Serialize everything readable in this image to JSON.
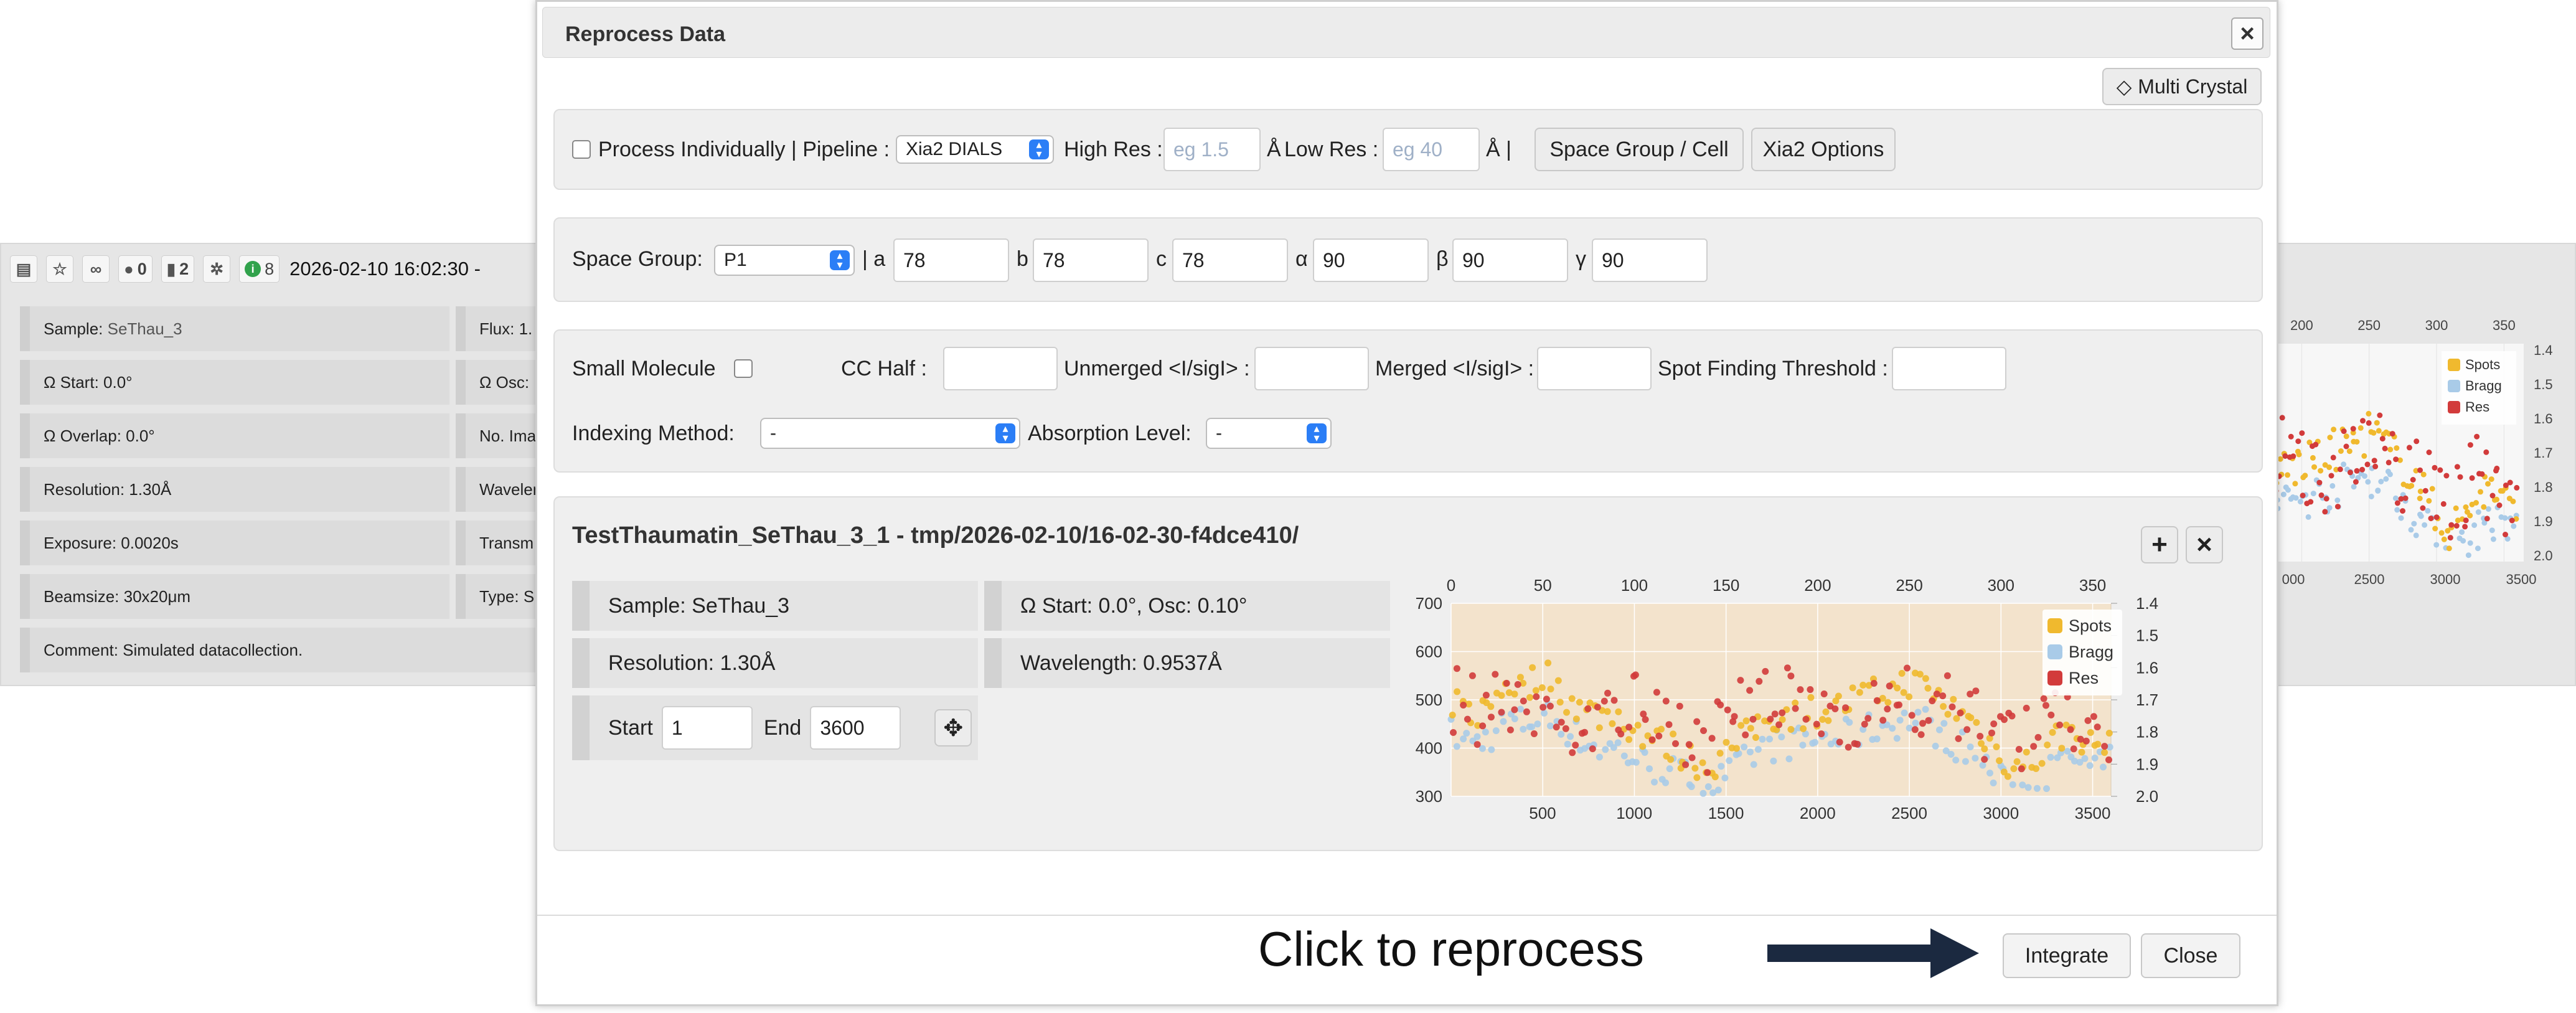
{
  "background": {
    "toolbar": {
      "comments_count": "0",
      "files_count": "2",
      "info_count": "8",
      "datetime": "2026-02-10 16:02:30 -"
    },
    "left_rows": [
      {
        "label": "Sample: ",
        "value": "SeThau_3"
      },
      {
        "label": "Ω Start: 0.0°",
        "value": ""
      },
      {
        "label": "Ω Overlap: 0.0°",
        "value": ""
      },
      {
        "label": "Resolution: 1.30Å",
        "value": ""
      },
      {
        "label": "Exposure: 0.0020s",
        "value": ""
      },
      {
        "label": "Beamsize: 30x20μm",
        "value": ""
      },
      {
        "label": "Comment: Simulated datacollection.",
        "value": ""
      }
    ],
    "right_col_rows": [
      "Flux: 1.",
      "Ω Osc: ",
      "No. Ima",
      "Wavelen",
      "Transm",
      "Type: S"
    ],
    "right_chart": {
      "x_top_ticks": [
        "200",
        "250",
        "300",
        "350"
      ],
      "x_bottom_ticks": [
        "000",
        "2500",
        "3000",
        "3500"
      ],
      "y_right_ticks": [
        "1.4",
        "1.5",
        "1.6",
        "1.7",
        "1.8",
        "1.9",
        "2.0"
      ],
      "legend": [
        "Spots",
        "Bragg",
        "Res"
      ]
    }
  },
  "modal": {
    "title": "Reprocess Data",
    "multi_crystal_label": "Multi Crystal",
    "pipeline_panel": {
      "process_individually_label": "Process Individually | Pipeline :",
      "pipeline_value": "Xia2 DIALS",
      "high_res_label": "High Res :",
      "high_res_placeholder": "eg 1.5",
      "angstrom_unit": "Å",
      "low_res_label": "Low Res :",
      "low_res_placeholder": "eg 40",
      "angstrom_sep": "Å |",
      "space_group_cell_button": "Space Group / Cell",
      "xia2_options_button": "Xia2 Options"
    },
    "cell_panel": {
      "space_group_label": "Space Group:",
      "space_group_value": "P1",
      "a_label": "| a",
      "a_value": "78",
      "b_label": "b",
      "b_value": "78",
      "c_label": "c",
      "c_value": "78",
      "alpha_label": "α",
      "alpha_value": "90",
      "beta_label": "β",
      "beta_value": "90",
      "gamma_label": "γ",
      "gamma_value": "90"
    },
    "options_panel": {
      "small_molecule_label": "Small Molecule",
      "cc_half_label": "CC Half :",
      "unmerged_label": "Unmerged <I/sigI> :",
      "merged_label": "Merged <I/sigI> :",
      "spot_threshold_label": "Spot Finding Threshold :",
      "indexing_method_label": "Indexing Method:",
      "indexing_method_value": "-",
      "absorption_level_label": "Absorption Level:",
      "absorption_level_value": "-"
    },
    "dataset": {
      "title": "TestThaumatin_SeThau_3_1 - tmp/2026-02-10/16-02-30-f4dce410/",
      "sample": "Sample: SeThau_3",
      "omega": "Ω Start: 0.0°, Osc: 0.10°",
      "resolution": "Resolution: 1.30Å",
      "wavelength": "Wavelength: 0.9537Å",
      "start_label": "Start",
      "start_value": "1",
      "end_label": "End",
      "end_value": "3600"
    },
    "footer": {
      "annotation": "Click to reprocess",
      "integrate_button": "Integrate",
      "close_button": "Close"
    }
  },
  "colors": {
    "spots": "#f0b92e",
    "bragg": "#a9cbe8",
    "res": "#d23b3b",
    "plot_bg": "#f3e3cc",
    "arrow": "#1b2940"
  },
  "chart_data": {
    "type": "scatter",
    "x_top_ticks": [
      "0",
      "50",
      "100",
      "150",
      "200",
      "250",
      "300",
      "350"
    ],
    "x_bottom_ticks": [
      "500",
      "1000",
      "1500",
      "2000",
      "2500",
      "3000",
      "3500"
    ],
    "y_left_ticks": [
      "700",
      "600",
      "500",
      "400",
      "300"
    ],
    "y_right_ticks": [
      "1.4",
      "1.5",
      "1.6",
      "1.7",
      "1.8",
      "1.9",
      "2.0"
    ],
    "x_top_range": [
      0,
      360
    ],
    "x_bottom_range": [
      1,
      3600
    ],
    "y_left_range": [
      300,
      700
    ],
    "y_right_range": [
      1.4,
      2.0
    ],
    "legend_position": "top-right",
    "series": [
      {
        "name": "Spots",
        "x_top": [
          0,
          10,
          20,
          30,
          40,
          50,
          60,
          70,
          80,
          90,
          100,
          110,
          120,
          130,
          140,
          150,
          160,
          170,
          180,
          190,
          200,
          210,
          220,
          230,
          240,
          250,
          260,
          270,
          280,
          290,
          300,
          310,
          320,
          330,
          340,
          350,
          360
        ],
        "values": [
          500,
          470,
          480,
          540,
          520,
          560,
          520,
          480,
          470,
          470,
          440,
          420,
          400,
          380,
          360,
          390,
          420,
          460,
          470,
          470,
          480,
          480,
          500,
          510,
          520,
          540,
          520,
          490,
          470,
          430,
          380,
          360,
          380,
          420,
          440,
          400,
          420
        ]
      },
      {
        "name": "Bragg",
        "x_top": [
          0,
          10,
          20,
          30,
          40,
          50,
          60,
          70,
          80,
          90,
          100,
          110,
          120,
          130,
          140,
          150,
          160,
          170,
          180,
          190,
          200,
          210,
          220,
          230,
          240,
          250,
          260,
          270,
          280,
          290,
          300,
          310,
          320,
          330,
          340,
          350,
          360
        ],
        "values": [
          430,
          410,
          420,
          460,
          450,
          470,
          450,
          420,
          400,
          400,
          380,
          360,
          350,
          340,
          320,
          340,
          370,
          400,
          410,
          410,
          420,
          420,
          430,
          440,
          450,
          460,
          450,
          420,
          400,
          370,
          330,
          310,
          330,
          360,
          380,
          350,
          370
        ]
      },
      {
        "name": "Res",
        "x_top": [
          0,
          10,
          20,
          30,
          40,
          50,
          60,
          70,
          80,
          90,
          100,
          110,
          120,
          130,
          140,
          150,
          160,
          170,
          180,
          190,
          200,
          210,
          220,
          230,
          240,
          250,
          260,
          270,
          280,
          290,
          300,
          310,
          320,
          330,
          340,
          350,
          360
        ],
        "values": [
          1.7,
          1.72,
          1.75,
          1.69,
          1.72,
          1.74,
          1.76,
          1.77,
          1.78,
          1.74,
          1.72,
          1.78,
          1.8,
          1.79,
          1.82,
          1.77,
          1.74,
          1.72,
          1.7,
          1.73,
          1.72,
          1.75,
          1.74,
          1.72,
          1.7,
          1.71,
          1.72,
          1.73,
          1.76,
          1.78,
          1.8,
          1.82,
          1.8,
          1.78,
          1.76,
          1.8,
          1.82
        ]
      }
    ]
  }
}
